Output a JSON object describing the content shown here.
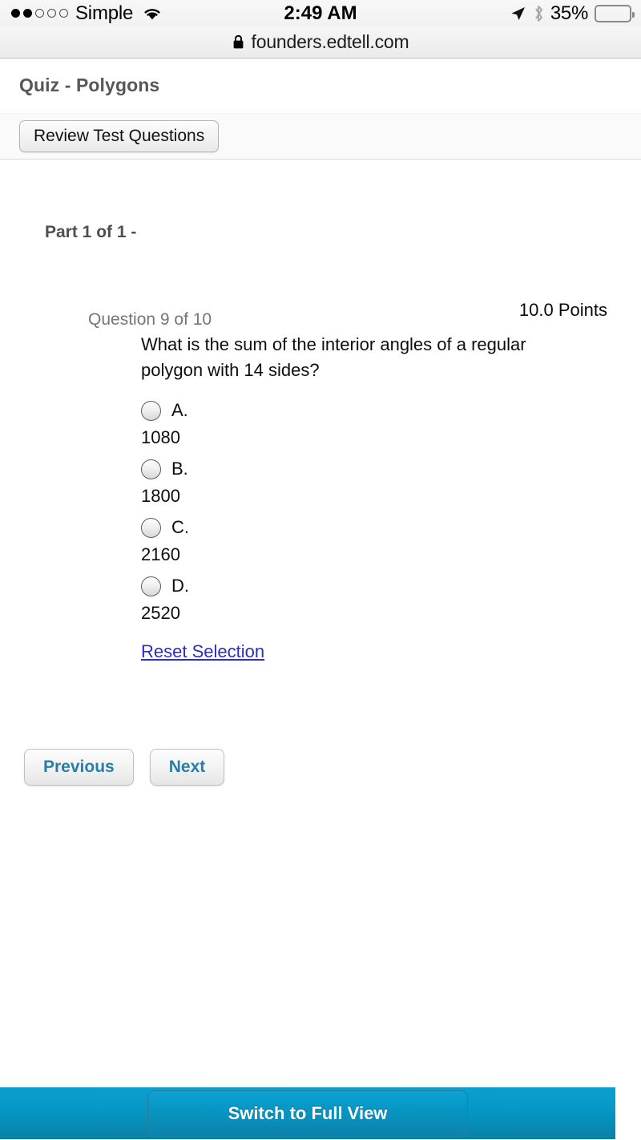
{
  "status_bar": {
    "carrier": "Simple",
    "signal_filled": 2,
    "signal_total": 5,
    "wifi_icon": "wifi-icon",
    "time": "2:49 AM",
    "location_icon": "location-arrow-icon",
    "bluetooth_icon": "bluetooth-icon",
    "battery_percent": "35%",
    "battery_level": 35,
    "battery_color": "#ffcc00"
  },
  "browser": {
    "lock_icon": "lock-icon",
    "url": "founders.edtell.com"
  },
  "page": {
    "title": "Quiz - Polygons",
    "toolbar": {
      "review_label": "Review Test Questions"
    },
    "part_label": "Part 1 of 1 -",
    "question": {
      "number_label": "Question 9 of 10",
      "points_label": "10.0 Points",
      "text": "What is the sum of the interior angles of a regular polygon with 14 sides?",
      "options": [
        {
          "letter": "A.",
          "value": "1080",
          "selected": false
        },
        {
          "letter": "B.",
          "value": "1800",
          "selected": false
        },
        {
          "letter": "C.",
          "value": "2160",
          "selected": false
        },
        {
          "letter": "D.",
          "value": "2520",
          "selected": false
        }
      ],
      "reset_label": "Reset Selection"
    },
    "navigation": {
      "previous_label": "Previous",
      "next_label": "Next"
    }
  },
  "bottom_bar": {
    "switch_label": "Switch to Full View",
    "background_color": "#0897c5"
  }
}
